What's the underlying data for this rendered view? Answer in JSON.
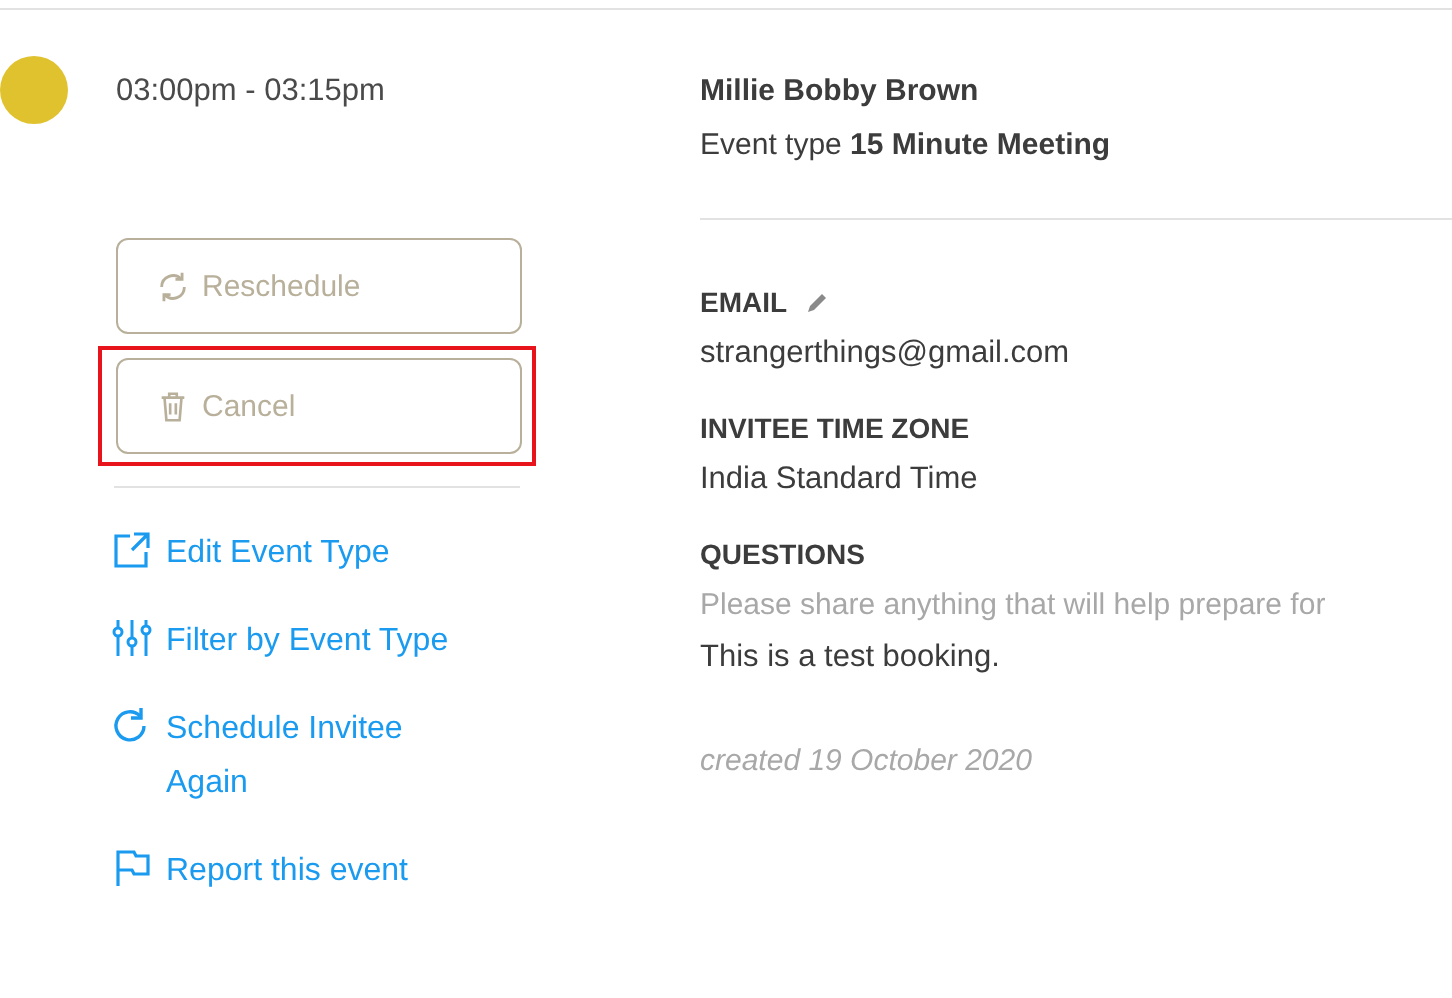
{
  "event": {
    "color": "#e0c22e",
    "time": "03:00pm - 03:15pm"
  },
  "buttons": [
    {
      "label": "Reschedule",
      "highlighted": false
    },
    {
      "label": "Cancel",
      "highlighted": true
    }
  ],
  "links": [
    {
      "label": "Edit Event Type"
    },
    {
      "label": "Filter by Event Type"
    },
    {
      "label": "Schedule Invitee Again"
    },
    {
      "label": "Report this event"
    }
  ],
  "invitee": {
    "name": "Millie Bobby Brown",
    "event_type": "Event type **15 Minute Meeting**"
  },
  "details": [
    {
      "label": "EMAIL",
      "editable": true,
      "values": [
        {
          "text": "strangerthings@gmail.com",
          "kind": "value"
        }
      ]
    },
    {
      "label": "INVITEE TIME ZONE",
      "editable": false,
      "values": [
        {
          "text": "India Standard Time",
          "kind": "value"
        }
      ]
    },
    {
      "label": "QUESTIONS",
      "editable": false,
      "values": [
        {
          "text": "Please share anything that will help prepare for",
          "kind": "question"
        },
        {
          "text": "This is a test booking.",
          "kind": "value"
        }
      ]
    }
  ],
  "created": "created 19 October 2020"
}
